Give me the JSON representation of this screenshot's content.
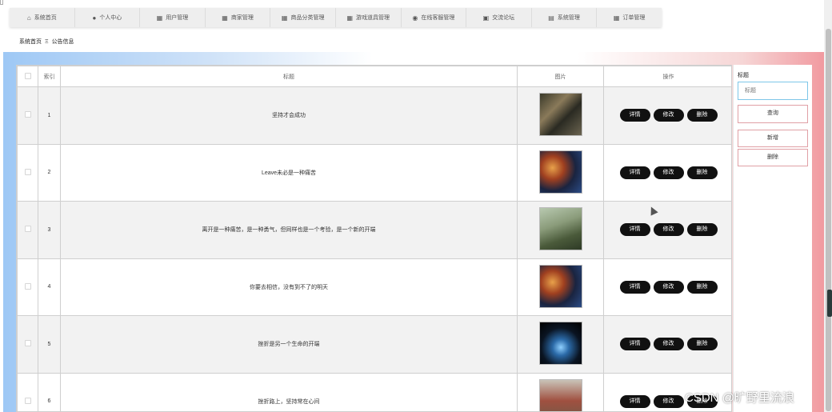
{
  "nav": [
    {
      "icon": "home-icon",
      "glyph": "⌂",
      "label": "系统首页"
    },
    {
      "icon": "user-icon",
      "glyph": "👤",
      "label": "个人中心"
    },
    {
      "icon": "user-manage-icon",
      "glyph": "▦",
      "label": "用户管理"
    },
    {
      "icon": "grid-icon",
      "glyph": "▦",
      "label": "商家管理"
    },
    {
      "icon": "grid-icon",
      "glyph": "▦",
      "label": "商品分类管理"
    },
    {
      "icon": "grid-icon",
      "glyph": "▦",
      "label": "游戏道具管理"
    },
    {
      "icon": "location-icon",
      "glyph": "◉",
      "label": "在线客服管理"
    },
    {
      "icon": "forum-icon",
      "glyph": "▣",
      "label": "交流论坛"
    },
    {
      "icon": "system-icon",
      "glyph": "▤",
      "label": "系统管理"
    },
    {
      "icon": "grid-icon",
      "glyph": "▦",
      "label": "订单管理"
    }
  ],
  "breadcrumb": {
    "home": "系统首页",
    "sep": "Ξ",
    "current": "公告信息"
  },
  "table": {
    "headers": {
      "index": "索引",
      "title": "标题",
      "image": "图片",
      "action": "操作"
    },
    "rows": [
      {
        "index": "1",
        "title": "坚持才会成功"
      },
      {
        "index": "2",
        "title": "Leave未必是一种痛苦"
      },
      {
        "index": "3",
        "title": "离开是一种痛苦，是一种勇气，但同样也是一个考验，是一个新的开端"
      },
      {
        "index": "4",
        "title": "你要去相信，没有到不了的明天"
      },
      {
        "index": "5",
        "title": "挫折是另一个生命的开端"
      },
      {
        "index": "6",
        "title": "挫折路上，坚持常在心间"
      }
    ],
    "buttons": {
      "detail": "详情",
      "edit": "修改",
      "delete": "删除"
    }
  },
  "side": {
    "label": "标题",
    "placeholder": "标题",
    "query": "查询",
    "add": "新增",
    "delete": "删除"
  },
  "watermark": "CSDN @旷野里流浪"
}
